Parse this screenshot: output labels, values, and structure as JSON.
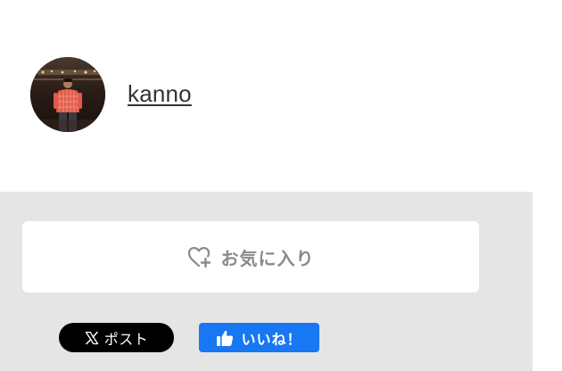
{
  "author": {
    "name": "kanno",
    "avatar_icon": "user-avatar-photo"
  },
  "favorite": {
    "label": "お気に入り",
    "icon": "heart-plus-icon",
    "icon_color": "#8a8a8a"
  },
  "share": {
    "x_post_label": "ポスト",
    "x_icon": "x-logo-icon",
    "fb_like_label": "いいね！",
    "fb_icon": "thumbs-up-icon",
    "colors": {
      "x_background": "#000000",
      "fb_background": "#1877f2"
    }
  },
  "panel": {
    "background": "#e5e5e5"
  }
}
